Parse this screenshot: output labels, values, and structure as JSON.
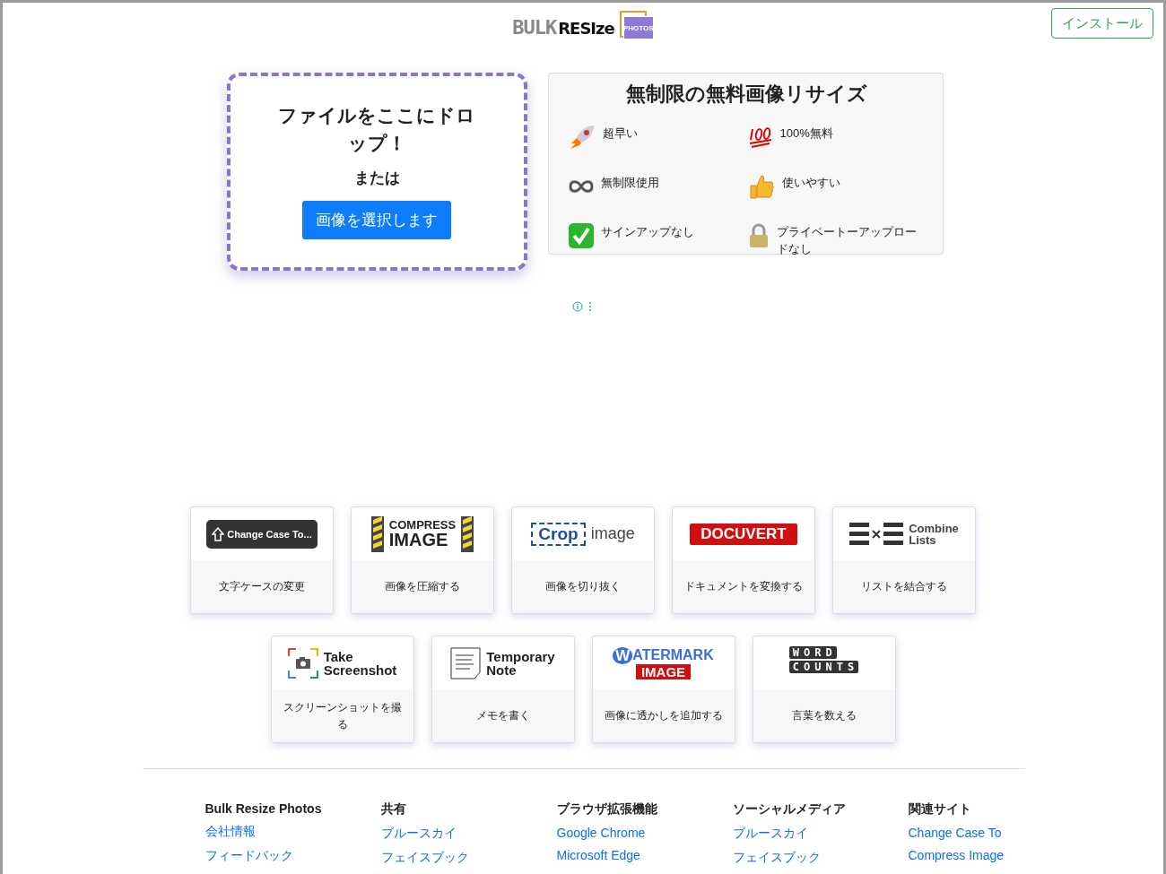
{
  "header": {
    "logo": {
      "word_1": "BULK",
      "word_2": "RESIze",
      "badge": "PHOTOS"
    },
    "install_button": "インストール"
  },
  "drop_zone": {
    "title": "ファイルをここにドロップ！",
    "or": "または",
    "button": "画像を選択します"
  },
  "features": {
    "title": "無制限の無料画像リサイズ",
    "items": [
      {
        "label": "超早い"
      },
      {
        "label": "100%無料"
      },
      {
        "label": "無制限使用"
      },
      {
        "label": "使いやすい"
      },
      {
        "label": "サインアップなし"
      },
      {
        "label": "プライベートーアップロードなし"
      }
    ]
  },
  "tools": [
    {
      "kind": "change-case",
      "logo_text": [
        "Change Case To..."
      ],
      "label": "文字ケースの変更"
    },
    {
      "kind": "compress",
      "logo_text": [
        "COMPRESS",
        "IMAGE"
      ],
      "label": "画像を圧縮する"
    },
    {
      "kind": "crop",
      "logo_text": [
        "Crop",
        "image"
      ],
      "label": "画像を切り抜く"
    },
    {
      "kind": "docuvert",
      "logo_text": [
        "DOCUVERT"
      ],
      "label": "ドキュメントを変換する"
    },
    {
      "kind": "combine",
      "logo_text": [
        "Combine",
        "Lists"
      ],
      "label": "リストを結合する"
    },
    {
      "kind": "screenshot",
      "logo_text": [
        "Take",
        "Screenshot"
      ],
      "label": "スクリーンショットを撮る"
    },
    {
      "kind": "note",
      "logo_text": [
        "Temporary",
        "Note"
      ],
      "label": "メモを書く"
    },
    {
      "kind": "watermark",
      "logo_text": [
        "W",
        "ATERMARK",
        "IMAGE"
      ],
      "label": "画像に透かしを追加する"
    },
    {
      "kind": "word-counts",
      "logo_text": [
        "WORD",
        "COUNTS"
      ],
      "label": "言葉を数える"
    }
  ],
  "footer": {
    "columns": [
      {
        "heading": "Bulk Resize Photos",
        "links": [
          "会社情報",
          "フィードバック"
        ]
      },
      {
        "heading": "共有",
        "links": [
          "ブルースカイ",
          "フェイスブック"
        ]
      },
      {
        "heading": "ブラウザ拡張機能",
        "links": [
          "Google Chrome",
          "Microsoft Edge"
        ]
      },
      {
        "heading": "ソーシャルメディア",
        "links": [
          "ブルースカイ",
          "フェイスブック"
        ]
      },
      {
        "heading": "関連サイト",
        "links": [
          "Change Case To",
          "Compress Image"
        ]
      }
    ]
  }
}
